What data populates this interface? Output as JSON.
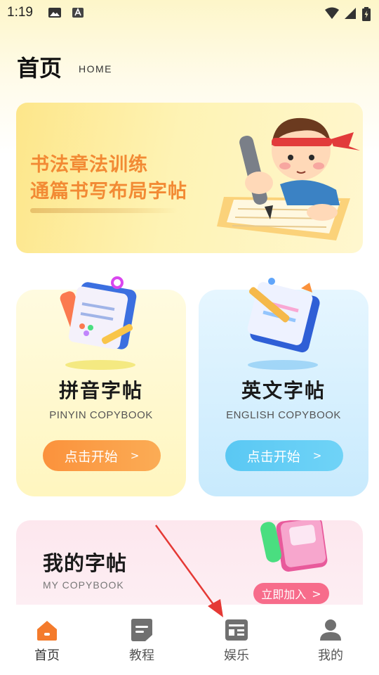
{
  "status_bar": {
    "time": "1:19"
  },
  "header": {
    "title": "首页",
    "subtitle": "HOME"
  },
  "banner": {
    "line1": "书法章法训练",
    "line2": "通篇书写布局字帖"
  },
  "cards": [
    {
      "title": "拼音字帖",
      "subtitle": "PINYIN COPYBOOK",
      "button": "点击开始",
      "arrow": ">"
    },
    {
      "title": "英文字帖",
      "subtitle": "ENGLISH COPYBOOK",
      "button": "点击开始",
      "arrow": ">"
    }
  ],
  "my_copybook": {
    "title": "我的字帖",
    "subtitle": "MY COPYBOOK",
    "button": "立即加入",
    "arrow": ">"
  },
  "bottom_nav": [
    {
      "label": "首页",
      "icon": "home-icon",
      "active": true
    },
    {
      "label": "教程",
      "icon": "tutorial-icon",
      "active": false
    },
    {
      "label": "娱乐",
      "icon": "entertainment-icon",
      "active": false
    },
    {
      "label": "我的",
      "icon": "profile-icon",
      "active": false
    }
  ],
  "colors": {
    "accent_orange": "#fb923c",
    "accent_blue": "#5ac8f3",
    "accent_pink": "#f76c8b",
    "banner_text": "#f28a34",
    "annotation": "#e53935"
  }
}
